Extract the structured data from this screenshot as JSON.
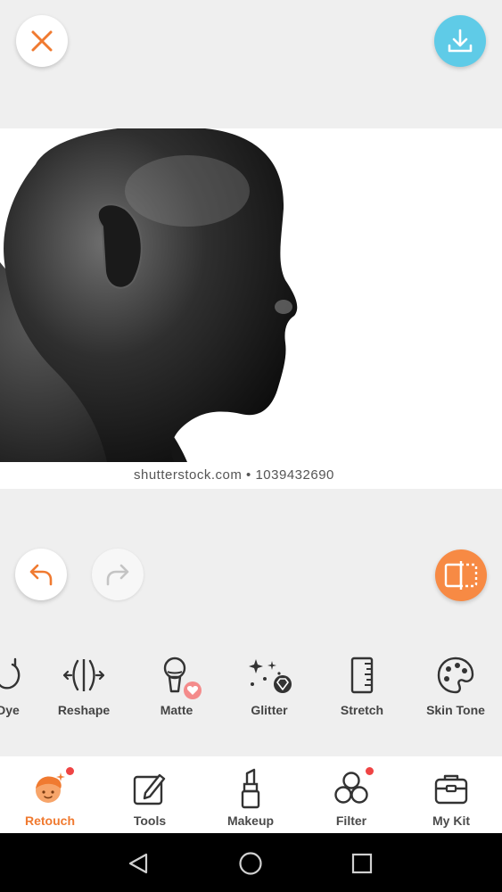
{
  "photo": {
    "watermark": "shutterstock.com • 1039432690"
  },
  "tools": [
    {
      "label": "Dye",
      "icon": "dye-icon"
    },
    {
      "label": "Reshape",
      "icon": "reshape-icon"
    },
    {
      "label": "Matte",
      "icon": "matte-icon"
    },
    {
      "label": "Glitter",
      "icon": "glitter-icon"
    },
    {
      "label": "Stretch",
      "icon": "stretch-icon"
    },
    {
      "label": "Skin Tone",
      "icon": "skin-tone-icon"
    }
  ],
  "tabs": [
    {
      "label": "Retouch",
      "icon": "retouch-icon",
      "active": true,
      "badge": true
    },
    {
      "label": "Tools",
      "icon": "tools-icon",
      "active": false,
      "badge": false
    },
    {
      "label": "Makeup",
      "icon": "makeup-icon",
      "active": false,
      "badge": false
    },
    {
      "label": "Filter",
      "icon": "filter-icon",
      "active": false,
      "badge": true
    },
    {
      "label": "My Kit",
      "icon": "my-kit-icon",
      "active": false,
      "badge": false
    }
  ],
  "colors": {
    "accent": "#f07a30",
    "download": "#5fcbe7",
    "badge": "#ef4444"
  }
}
